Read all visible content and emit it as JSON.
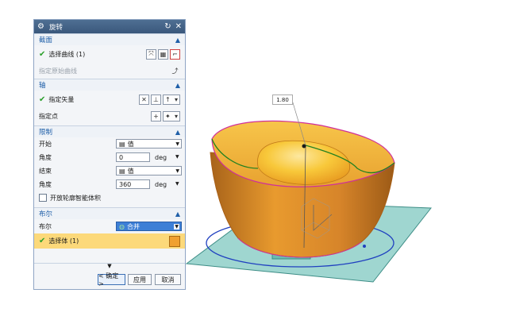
{
  "dialog": {
    "title": "旋转",
    "title_icon": "gear-icon",
    "reset_icon": "reset-icon",
    "close_icon": "close-icon"
  },
  "section_profile": {
    "header": "截面",
    "select_curve": "选择曲线 (1)",
    "specify_origin_curve": "指定原始曲线"
  },
  "section_axis": {
    "header": "轴",
    "specify_vector": "指定矢量",
    "specify_point": "指定点"
  },
  "section_limits": {
    "header": "限制",
    "start_label": "开始",
    "start_mode": "值",
    "start_angle_label": "角度",
    "start_angle_value": "0",
    "start_unit": "deg",
    "end_label": "结束",
    "end_mode": "值",
    "end_angle_label": "角度",
    "end_angle_value": "360",
    "end_unit": "deg",
    "open_profile_label": "开放轮廓智能体积"
  },
  "section_boolean": {
    "header": "布尔",
    "boolean_label": "布尔",
    "boolean_value": "合并",
    "select_body": "选择体 (1)"
  },
  "footer": {
    "ok": "< 确定 >",
    "apply": "应用",
    "cancel": "取消"
  },
  "viewport": {
    "tag_label": "1.80",
    "colors": {
      "body_orange": "#e89a2e",
      "inner_yellow": "#f8c83a",
      "plane_teal": "#7fc8c0",
      "edge_magenta": "#d0309a",
      "curve_blue": "#2040c0",
      "curve_green": "#208020"
    }
  }
}
